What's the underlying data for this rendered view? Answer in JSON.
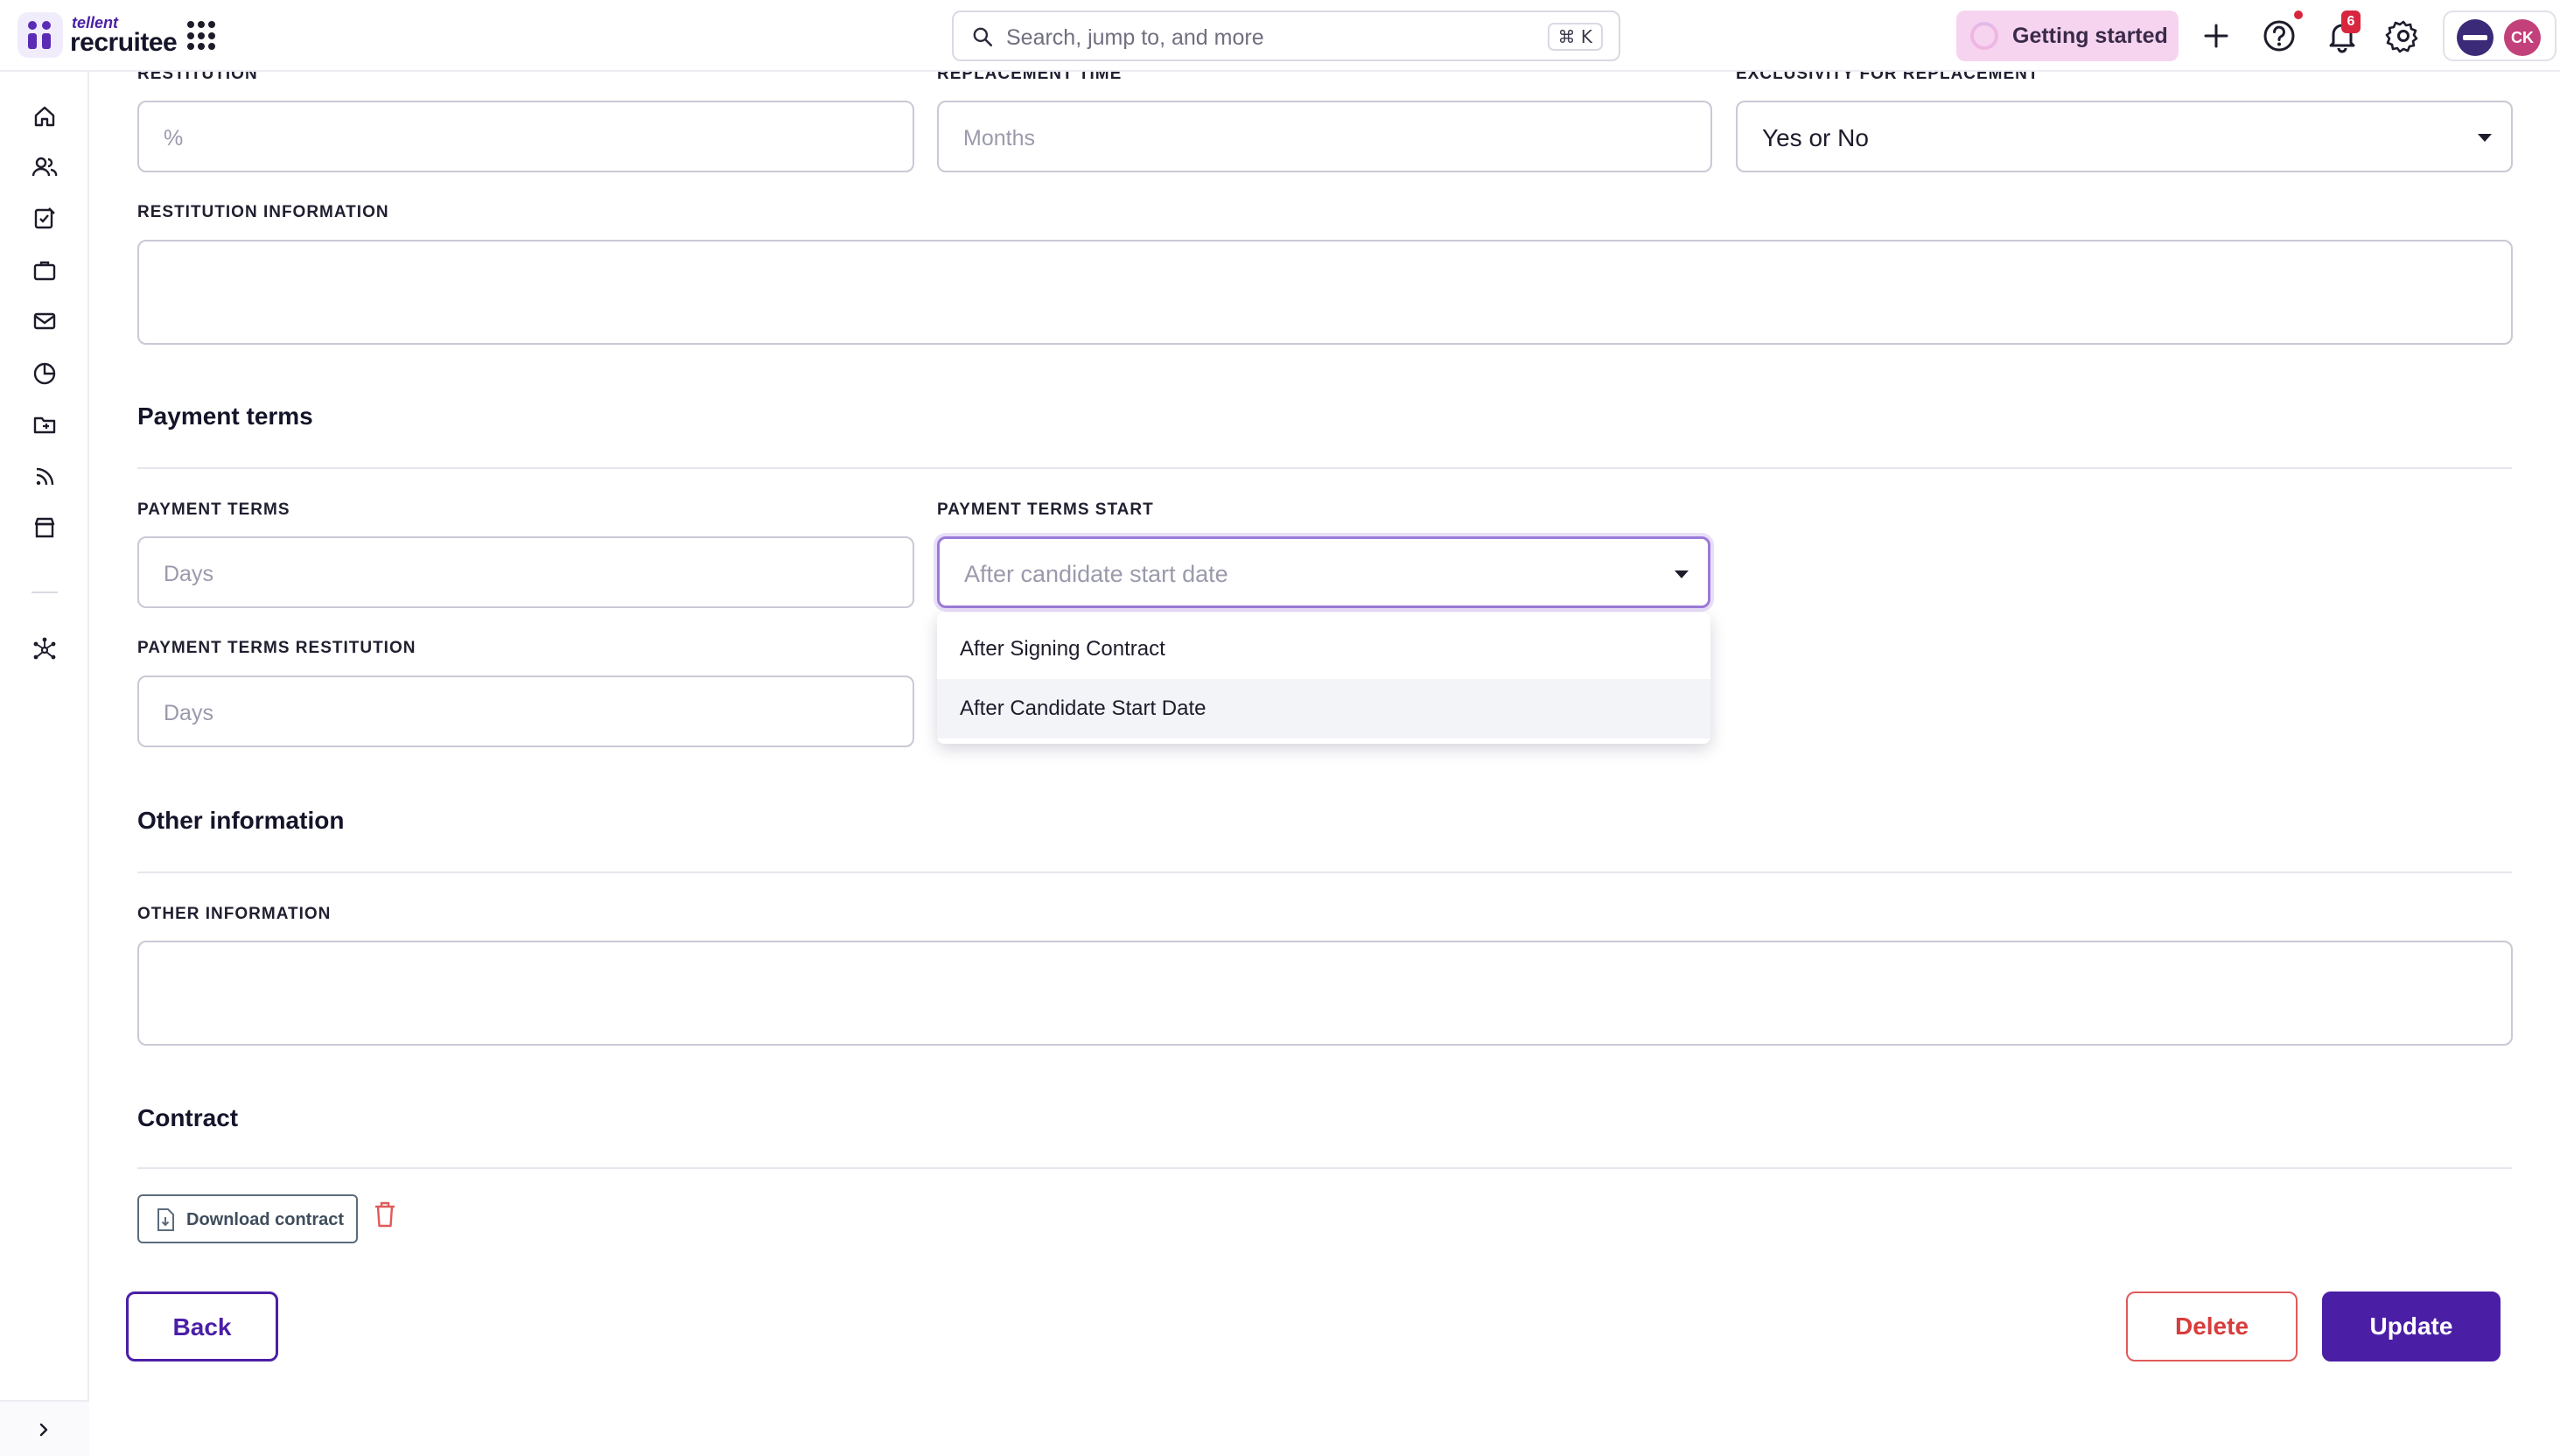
{
  "topbar": {
    "brand_small": "tellent",
    "brand_name": "recruitee",
    "search_placeholder": "Search, jump to, and more",
    "search_shortcut": "⌘ K",
    "getting_started": "Getting started",
    "notification_count": "6",
    "user_initials": "CK"
  },
  "sidebar": {
    "items": [
      "home-icon",
      "candidates-icon",
      "tasks-icon",
      "jobs-icon",
      "mail-icon",
      "reports-icon",
      "folder-icon",
      "feed-icon",
      "marketplace-icon",
      "integrations-icon"
    ],
    "collapse": "chevron-right-icon"
  },
  "form": {
    "restitution": {
      "label": "RESTITUTION",
      "placeholder": "%"
    },
    "replacement_time": {
      "label": "REPLACEMENT TIME",
      "placeholder": "Months"
    },
    "exclusivity": {
      "label": "EXCLUSIVITY FOR REPLACEMENT",
      "value": "Yes or No"
    },
    "restitution_information": {
      "label": "RESTITUTION INFORMATION",
      "value": ""
    },
    "payment_section_title": "Payment terms",
    "payment_terms": {
      "label": "PAYMENT TERMS",
      "placeholder": "Days"
    },
    "payment_terms_start": {
      "label": "PAYMENT TERMS START",
      "placeholder": "After candidate start date",
      "options": [
        "After Signing Contract",
        "After Candidate Start Date"
      ],
      "highlighted_option": "After Candidate Start Date"
    },
    "payment_terms_restitution": {
      "label": "PAYMENT TERMS RESTITUTION",
      "placeholder": "Days"
    },
    "other_section_title": "Other information",
    "other_information": {
      "label": "OTHER INFORMATION",
      "value": ""
    },
    "contract_section_title": "Contract",
    "download_contract": "Download contract"
  },
  "actions": {
    "back": "Back",
    "delete": "Delete",
    "update": "Update"
  },
  "colors": {
    "primary": "#4a1fa6",
    "danger": "#d83c3c",
    "getting_started_bg": "#f6d4ef",
    "notification": "#d7263d"
  }
}
